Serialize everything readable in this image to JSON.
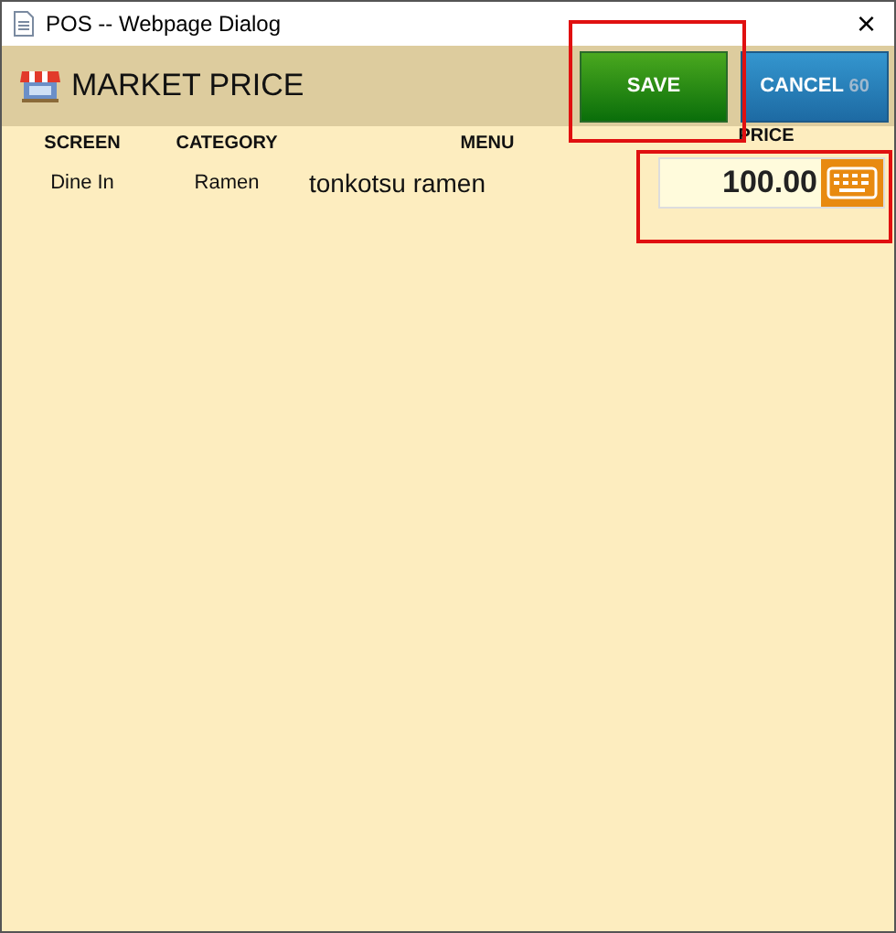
{
  "window": {
    "title": "POS -- Webpage Dialog",
    "close": "×"
  },
  "header": {
    "title": "MARKET PRICE",
    "save": "SAVE",
    "cancel": "CANCEL",
    "countdown": "60"
  },
  "table": {
    "columns": [
      "SCREEN",
      "CATEGORY",
      "MENU",
      "PRICE"
    ],
    "rows": [
      {
        "screen": "Dine In",
        "category": "Ramen",
        "menu": "tonkotsu ramen",
        "price": "100.00"
      }
    ]
  }
}
